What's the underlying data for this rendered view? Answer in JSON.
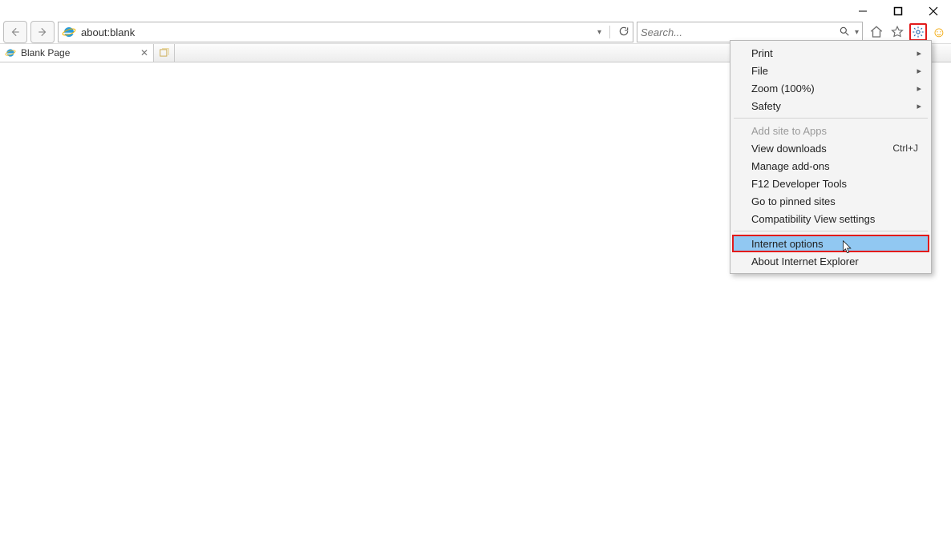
{
  "window": {
    "minimize_tooltip": "Minimize",
    "maximize_tooltip": "Maximize",
    "close_tooltip": "Close"
  },
  "address_bar": {
    "url": "about:blank",
    "refresh_tooltip": "Refresh"
  },
  "search_box": {
    "placeholder": "Search..."
  },
  "tabs": {
    "active": {
      "title": "Blank Page"
    }
  },
  "menu": {
    "print": "Print",
    "file": "File",
    "zoom": "Zoom (100%)",
    "safety": "Safety",
    "add_site": "Add site to Apps",
    "view_downloads": "View downloads",
    "view_downloads_shortcut": "Ctrl+J",
    "manage_addons": "Manage add-ons",
    "dev_tools": "F12 Developer Tools",
    "pinned_sites": "Go to pinned sites",
    "compat_view": "Compatibility View settings",
    "internet_options": "Internet options",
    "about": "About Internet Explorer"
  }
}
